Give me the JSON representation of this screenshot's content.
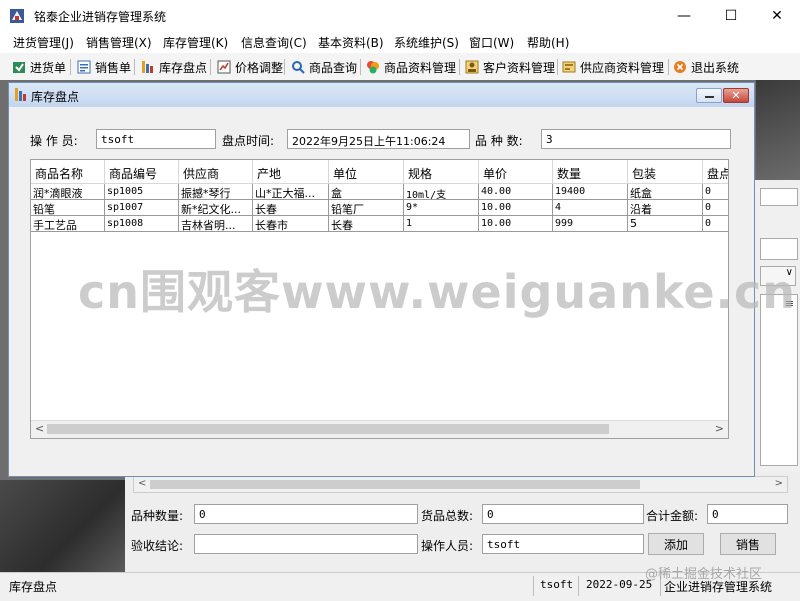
{
  "window": {
    "title": "铭泰企业进销存管理系统",
    "minimize": "—",
    "maximize": "☐",
    "close": "✕"
  },
  "menu": [
    "进货管理(J)",
    "销售管理(X)",
    "库存管理(K)",
    "信息查询(C)",
    "基本资料(B)",
    "系统维护(S)",
    "窗口(W)",
    "帮助(H)"
  ],
  "toolbar": [
    {
      "label": "进货单",
      "icon": "purchase-order-icon"
    },
    {
      "label": "销售单",
      "icon": "sales-order-icon"
    },
    {
      "label": "库存盘点",
      "icon": "inventory-check-icon"
    },
    {
      "label": "价格调整",
      "icon": "price-adjust-icon"
    },
    {
      "label": "商品查询",
      "icon": "product-search-icon"
    },
    {
      "label": "商品资料管理",
      "icon": "product-data-icon"
    },
    {
      "label": "客户资料管理",
      "icon": "customer-data-icon"
    },
    {
      "label": "供应商资料管理",
      "icon": "supplier-data-icon"
    },
    {
      "label": "退出系统",
      "icon": "exit-icon"
    }
  ],
  "dialog": {
    "title": "库存盘点",
    "operator_label": "操 作 员:",
    "operator_value": "tsoft",
    "time_label": "盘点时间:",
    "time_value": "2022年9月25日上午11:06:24",
    "count_label": "品 种 数:",
    "count_value": "3",
    "columns": [
      "商品名称",
      "商品编号",
      "供应商",
      "产地",
      "单位",
      "规格",
      "单价",
      "数量",
      "包装",
      "盘点"
    ],
    "rows": [
      [
        "润*滴眼液",
        "sp1005",
        "振撼*琴行",
        "山*正大福...",
        "盒",
        "10ml/支",
        "40.00",
        "19400",
        "纸盒",
        "0"
      ],
      [
        "铅笔",
        "sp1007",
        "新*纪文化...",
        "长春",
        "铅笔厂",
        "9*",
        "10.00",
        "4",
        "沿着",
        "0"
      ],
      [
        "手工艺品",
        "sp1008",
        "吉林省明...",
        "长春市",
        "长春",
        "1",
        "10.00",
        "999",
        "5",
        "0"
      ]
    ]
  },
  "sales_form": {
    "variety_qty_label": "品种数量:",
    "variety_qty_value": "0",
    "total_qty_label": "货品总数:",
    "total_qty_value": "0",
    "total_amount_label": "合计金额:",
    "total_amount_value": "0",
    "conclusion_label": "验收结论:",
    "conclusion_value": "",
    "operator_label": "操作人员:",
    "operator_value": "tsoft",
    "add_button": "添加",
    "sell_button": "销售",
    "strip_combo_arrow": "∨",
    "strip_list_mark": "≡"
  },
  "status": {
    "module": "库存盘点",
    "user": "tsoft",
    "date": "2022-09-25",
    "system": "企业进销存管理系统"
  },
  "watermarks": {
    "center": "cn围观客www.weiguanke.cn",
    "corner": "@稀土掘金技术社区"
  },
  "colors": {
    "dialog_title_bg": "#c3d6ef",
    "close_button": "#c5473a"
  }
}
